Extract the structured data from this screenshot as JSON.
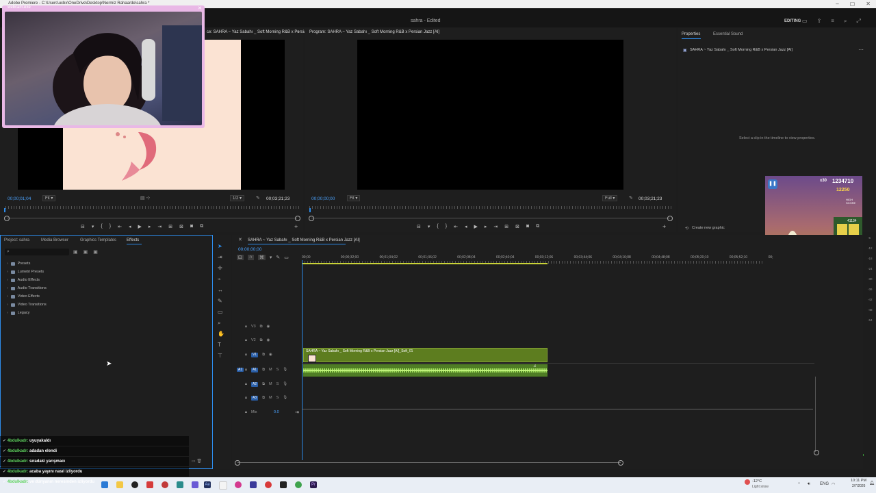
{
  "window": {
    "title": "Adobe Premiere - C:\\Users\\ucbx\\OneDrive\\Desktop\\Nermiz Rahaarde\\sahra *",
    "doc_title": "sahra - Edited",
    "workspace": "EDITING"
  },
  "webcam": {
    "label": "webcam.exe"
  },
  "source_monitor": {
    "tab": "ce: SAHRA ~ Yaz Sabahı _ Soft Morning R&B x Persian",
    "timecode": "00;00;01;04",
    "fit": "Fit",
    "resolution": "1/2",
    "duration": "00;03;21;23"
  },
  "program_monitor": {
    "tab": "Program: SAHRA ~ Yaz Sabahı _ Soft Morning R&B x Persian Jazz [AI]",
    "timecode": "00;00;00;00",
    "fit": "Fit",
    "resolution": "Full",
    "duration": "00;03;21;23"
  },
  "properties": {
    "tabs": [
      "Properties",
      "Essential Sound"
    ],
    "clip_name": "SAHRA ~ Yaz Sabahı _ Soft Morning R&B x Persian Jazz [AI]",
    "empty_hint": "Select a clip in the timeline to view properties.",
    "create_graphic": "Create new graphic"
  },
  "game": {
    "multiplier": "x30",
    "score": "1234710",
    "coins": "12250",
    "high_score_label": "HIGH SCORE",
    "high_score": "41134"
  },
  "project_panel": {
    "tabs": [
      "Project: sahra",
      "Media Browser",
      "Graphics Templates",
      "Effects"
    ],
    "tree": [
      "Presets",
      "Lumetri Presets",
      "Audio Effects",
      "Audio Transitions",
      "Video Effects",
      "Video Transitions",
      "Legacy"
    ]
  },
  "timeline": {
    "sequence_tab": "SAHRA ~ Yaz Sabahı _ Soft Morning R&B x Persian Jazz [AI]",
    "timecode": "00;00;00;00",
    "ruler_labels": [
      "00;00",
      "00;00;32;00",
      "00;01;04;02",
      "00;01;36;02",
      "00;02;08;04",
      "00;02;40;04",
      "00;03;12;06",
      "00;03;44;06",
      "00;04;16;08",
      "00;04;48;08",
      "00;05;20;10",
      "00;05;52;10",
      "00;"
    ],
    "video_tracks": [
      "V3",
      "V2",
      "V1"
    ],
    "audio_tracks": [
      "A1",
      "A2",
      "A3"
    ],
    "mix_label": "Mix",
    "mix_value": "0.0",
    "clip_label": "SAHRA ~ Yaz Sabahı _ Soft Morning R&B x Persian Jazz [AI]_Soft_01",
    "meter_labels": [
      "-6",
      "-12",
      "-18",
      "-24",
      "-30",
      "-36",
      "-42",
      "-48",
      "-54"
    ]
  },
  "chat": [
    {
      "user": "4bdulkadr:",
      "msg": "uyuyakaldı"
    },
    {
      "user": "4bdulkadr:",
      "msg": "adadan elendi"
    },
    {
      "user": "4bdulkadr:",
      "msg": "sıradaki yarışmacı"
    },
    {
      "user": "4bdulkadr:",
      "msg": "acaba yayını nasıl izliyordu"
    },
    {
      "user": "4bdulkadr:",
      "msg": "ve dünyanın neresinden izliyordu"
    }
  ],
  "taskbar": {
    "weather_temp": "-12°C",
    "weather_desc": "Light snow",
    "lang": "ENG",
    "time": "10:11 PM",
    "date": "2/7/2026"
  },
  "colors": {
    "accent_blue": "#2d8ceb",
    "clip_green": "#5d7d1f",
    "audio_green": "#6ea52c",
    "webcam_border": "#e9b8e6"
  }
}
